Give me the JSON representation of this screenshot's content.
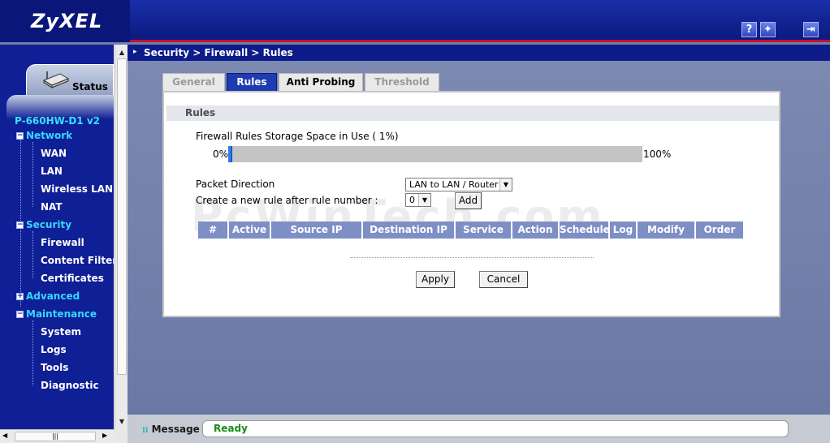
{
  "brand": {
    "logo": "ZyXEL",
    "help_icon": "help-icon",
    "wizard_icon": "wizard-icon",
    "logout_icon": "logout-icon"
  },
  "sidebar": {
    "status_label": "Status",
    "model": "P-660HW-D1 v2",
    "groups": [
      {
        "label": "Network",
        "expanded": true,
        "items": [
          "WAN",
          "LAN",
          "Wireless LAN",
          "NAT"
        ]
      },
      {
        "label": "Security",
        "expanded": true,
        "items": [
          "Firewall",
          "Content Filter",
          "Certificates"
        ]
      },
      {
        "label": "Advanced",
        "expanded": false,
        "items": []
      },
      {
        "label": "Maintenance",
        "expanded": true,
        "items": [
          "System",
          "Logs",
          "Tools",
          "Diagnostic"
        ]
      }
    ]
  },
  "breadcrumb": "Security > Firewall > Rules",
  "tabs": [
    "General",
    "Rules",
    "Anti Probing",
    "Threshold"
  ],
  "active_tab": "Rules",
  "panel": {
    "section_title": "Rules",
    "storage_label": "Firewall Rules Storage Space in Use  ( 1%)",
    "storage_percent": 1,
    "bar_min": "0%",
    "bar_max": "100%",
    "direction_label": "Packet Direction",
    "direction_value": "LAN to LAN / Router",
    "create_label": "Create a new rule after rule number :",
    "rule_number_value": "0",
    "add_label": "Add",
    "columns": [
      "#",
      "Active",
      "Source IP",
      "Destination IP",
      "Service",
      "Action",
      "Schedule",
      "Log",
      "Modify",
      "Order"
    ],
    "apply_label": "Apply",
    "cancel_label": "Cancel",
    "watermark": "PcWinTech.com"
  },
  "message_bar": {
    "label": "Message",
    "status": "Ready"
  },
  "colors": {
    "banner": "#0d1f8c",
    "accent_red": "#c8102e",
    "menu_group": "#34d9ff",
    "table_header": "#7d8fc5",
    "status_text": "#1a8a1a"
  }
}
